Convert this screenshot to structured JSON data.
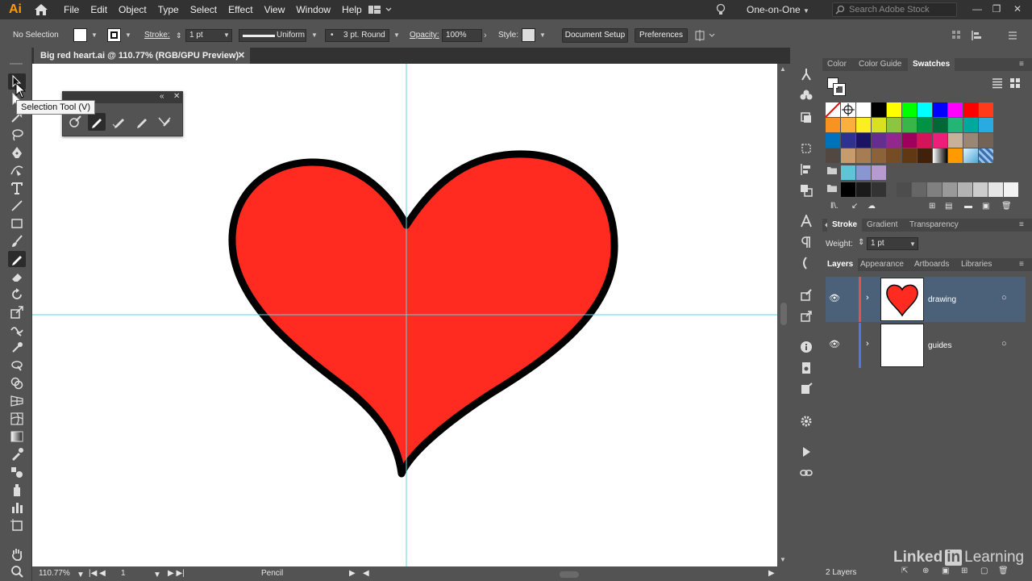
{
  "app": {
    "logo": "Ai",
    "menu": [
      "File",
      "Edit",
      "Object",
      "Type",
      "Select",
      "Effect",
      "View",
      "Window",
      "Help"
    ],
    "workspace": "One-on-One",
    "search_placeholder": "Search Adobe Stock"
  },
  "control_bar": {
    "selection": "No Selection",
    "stroke_label": "Stroke:",
    "stroke_weight": "1 pt",
    "profile": "Uniform",
    "brush": "3 pt. Round",
    "opacity_label": "Opacity:",
    "opacity": "100%",
    "style_label": "Style:",
    "document_setup": "Document Setup",
    "preferences": "Preferences"
  },
  "document": {
    "tab_title": "Big red heart.ai @ 110.77% (RGB/GPU Preview)",
    "close": "✕",
    "heart_fill": "#ff2b20",
    "stroke_color": "#000000",
    "guide_color": "#5ad7e6"
  },
  "tooltip": "Selection Tool (V)",
  "status": {
    "zoom": "110.77%",
    "artboard": "1",
    "tool": "Pencil"
  },
  "panels": {
    "color_tabs": [
      "Color",
      "Color Guide",
      "Swatches"
    ],
    "active_color_tab": "Swatches",
    "swatch_rows": [
      [
        "none",
        "registration",
        "#ffffff",
        "#000000",
        "#ffff00",
        "#00ff00",
        "#00ffff",
        "#0000ff",
        "#ff00ff",
        "#ff0000",
        "#ff3a1a"
      ],
      [
        "#f7931e",
        "#fbb03b",
        "#fcee21",
        "#d9e021",
        "#8cc63f",
        "#39b54a",
        "#009245",
        "#006837",
        "#22b573",
        "#00a99d",
        "#29abe2"
      ],
      [
        "#0071bc",
        "#2e3192",
        "#1b1464",
        "#662d91",
        "#93278f",
        "#9e005d",
        "#d4145a",
        "#ed1e79",
        "#c7b299",
        "#998675",
        "#736357"
      ],
      [
        "#534741",
        "#c69c6d",
        "#a67c52",
        "#8c6239",
        "#754c24",
        "#603813",
        "#42210b",
        "gradient-bw",
        "#ff9a00",
        "gradient-blue",
        "pattern"
      ]
    ],
    "swatch_group1": [
      "#5ec5d6",
      "#8a96d2",
      "#b79ad0"
    ],
    "swatch_gray": [
      "#000000",
      "#1a1a1a",
      "#333333",
      "#4d4d4d",
      "#666666",
      "#808080",
      "#999999",
      "#b3b3b3",
      "#cccccc",
      "#e6e6e6",
      "#f2f2f2"
    ],
    "stroke_tabs": [
      "Stroke",
      "Gradient",
      "Transparency"
    ],
    "weight_label": "Weight:",
    "weight_value": "1 pt",
    "layers_tabs": [
      "Layers",
      "Appearance",
      "Artboards",
      "Libraries"
    ],
    "layers": [
      {
        "name": "drawing",
        "color": "#e8504a",
        "selected": true
      },
      {
        "name": "guides",
        "color": "#4a78e8",
        "selected": false
      }
    ],
    "layers_count": "2 Layers"
  },
  "watermark": {
    "text": "Linked",
    "box": "in",
    "text2": "Learning"
  }
}
